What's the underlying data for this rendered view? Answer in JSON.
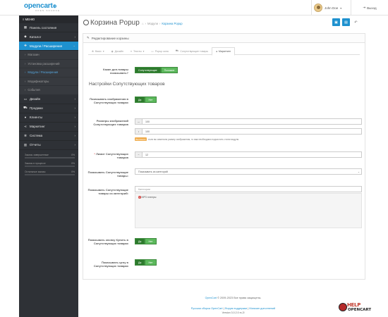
{
  "header": {
    "logo_text": "opencart",
    "logo_tagline": "OPEN SOURCE",
    "user_name": "John Doe",
    "logout_label": "Выход"
  },
  "sidebar": {
    "menu_title": "МЕНЮ",
    "items": [
      {
        "icon": "dashboard-icon",
        "label": "Панель состояния"
      },
      {
        "icon": "tags-icon",
        "label": "Каталог"
      },
      {
        "icon": "puzzle-icon",
        "label": "Модули / Расширения"
      },
      {
        "icon": "desktop-icon",
        "label": "Дизайн"
      },
      {
        "icon": "cart-icon",
        "label": "Продажи"
      },
      {
        "icon": "user-icon",
        "label": "Клиенты"
      },
      {
        "icon": "share-icon",
        "label": "Маркетинг"
      },
      {
        "icon": "cog-icon",
        "label": "Система"
      },
      {
        "icon": "chart-icon",
        "label": "Отчеты"
      }
    ],
    "sub_items": [
      {
        "label": "Магазин"
      },
      {
        "label": "Установка расширений"
      },
      {
        "label": "Модули / Расширения"
      },
      {
        "label": "Модификаторы"
      },
      {
        "label": "События"
      }
    ],
    "stats": [
      {
        "label": "Заказы завершенные",
        "value": "0%"
      },
      {
        "label": "Заказы в процессе",
        "value": "0%"
      },
      {
        "label": "Остальные заказы",
        "value": "0%"
      }
    ]
  },
  "page": {
    "title": "Корзина Popup",
    "breadcrumb": [
      "Модули",
      "Корзина Popup"
    ],
    "panel_title": "Редактирование корзины"
  },
  "tabs": [
    {
      "label": "Basic",
      "active": false
    },
    {
      "label": "Дизайн",
      "active": false
    },
    {
      "label": "Тексты",
      "active": false
    },
    {
      "label": "Popup окна",
      "active": false
    },
    {
      "label": "Сопутствующие товары",
      "active": false
    },
    {
      "label": "Маркетинг",
      "active": true
    }
  ],
  "form": {
    "which_products_label": "Какие доп.товары показывать?",
    "which_products_options": [
      "Сопутствующие",
      "Похожие"
    ],
    "section_title": "Настройки Сопутствующих товаров",
    "show_images_label": "Показывать изображения в Сопутствующих товарах",
    "yes_label": "Да",
    "no_label": "Нет",
    "image_size_label": "Размеры изображений Сопутствующих товаров",
    "width_value": "100",
    "height_value": "100",
    "hint_badge": "Внимание",
    "hint_text": "если вы изменили размер изображения, то вам необходимо подчистить стили модуля.",
    "limit_label": "Лимит Сопутствующих товаров",
    "limit_value": "12",
    "show_products_label": "Показывать Сопутствующие товары:",
    "show_products_select": "Показывать из категорий",
    "show_from_categories_label": "Показывать Сопутствующие товары из категорий:",
    "categories_placeholder": "Категории",
    "category_chip": "MP3 плееры",
    "show_buy_label": "Показывать кнопку Купить в Сопутствующих товарах",
    "show_price_label": "Показывать цену в Сопутствующих товарах"
  },
  "footer": {
    "copyright_link": "OpenCart",
    "copyright_text": "© 2009-2023 Все права защищены.",
    "links": [
      "Русская сборка OpenCart",
      "Форум поддержки",
      "Магазин дополнений"
    ],
    "version": "Version 3.0.2.0 rs.2l",
    "help_logo_top": "HELP",
    "help_logo_bottom": "OPENCART"
  },
  "colors": {
    "brand_blue": "#1e91cf",
    "sidebar_bg": "#2e3136",
    "toggle_green": "#5cb85c",
    "warning": "#f0ad4e"
  }
}
